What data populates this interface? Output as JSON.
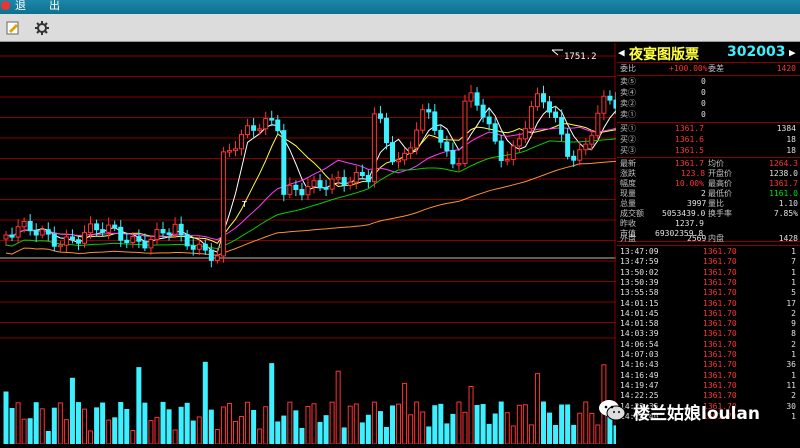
{
  "titlebar": {
    "menu_items": [
      "退",
      "出"
    ]
  },
  "toolbar": {
    "icons": [
      "edit-icon",
      "gear-icon"
    ]
  },
  "chart": {
    "high_label": "1751.2",
    "t_marker": "T"
  },
  "stock": {
    "name": "夜宴图版票",
    "code": "302003"
  },
  "quote_top": {
    "wei_label": "委比",
    "wei_value": "+100.00%",
    "weicha_label": "委差",
    "weicha_value": "1420"
  },
  "sell": [
    {
      "label": "卖⑤",
      "price": "",
      "vol": "0"
    },
    {
      "label": "卖④",
      "price": "",
      "vol": "0"
    },
    {
      "label": "卖②",
      "price": "",
      "vol": "0"
    },
    {
      "label": "卖①",
      "price": "",
      "vol": "0"
    }
  ],
  "buy": [
    {
      "label": "买①",
      "price": "1361.7",
      "vol": "1384"
    },
    {
      "label": "买②",
      "price": "1361.6",
      "vol": "18"
    },
    {
      "label": "买③",
      "price": "1361.5",
      "vol": "18"
    }
  ],
  "stats": [
    {
      "l1": "最新",
      "v1": "1361.7",
      "l2": "均价",
      "v2": "1264.3"
    },
    {
      "l1": "涨跌",
      "v1": "123.8",
      "l2": "开盘价",
      "v2": "1238.0"
    },
    {
      "l1": "幅度",
      "v1": "10.00%",
      "l2": "最高价",
      "v2": "1361.7"
    },
    {
      "l1": "现量",
      "v1": "2",
      "l2": "最低价",
      "v2": "1161.0"
    },
    {
      "l1": "总量",
      "v1": "3997",
      "l2": "量比",
      "v2": "1.10"
    },
    {
      "l1": "成交额",
      "v1": "5053439.0",
      "l2": "换手率",
      "v2": "7.85%"
    },
    {
      "l1": "昨收",
      "v1": "1237.9",
      "l2": "",
      "v2": ""
    },
    {
      "l1": "市值",
      "v1": "69302359.8",
      "l2": "",
      "v2": ""
    }
  ],
  "outin": {
    "out_label": "外盘",
    "out_value": "2569",
    "in_label": "内盘",
    "in_value": "1428"
  },
  "ticks": [
    {
      "time": "13:47:09",
      "price": "1361.70",
      "vol": "1"
    },
    {
      "time": "13:47:59",
      "price": "1361.70",
      "vol": "7"
    },
    {
      "time": "13:50:02",
      "price": "1361.70",
      "vol": "1"
    },
    {
      "time": "13:50:39",
      "price": "1361.70",
      "vol": "1"
    },
    {
      "time": "13:55:58",
      "price": "1361.70",
      "vol": "5"
    },
    {
      "time": "14:01:15",
      "price": "1361.70",
      "vol": "17"
    },
    {
      "time": "14:01:45",
      "price": "1361.70",
      "vol": "2"
    },
    {
      "time": "14:01:58",
      "price": "1361.70",
      "vol": "9"
    },
    {
      "time": "14:03:39",
      "price": "1361.70",
      "vol": "8"
    },
    {
      "time": "14:06:54",
      "price": "1361.70",
      "vol": "2"
    },
    {
      "time": "14:07:03",
      "price": "1361.70",
      "vol": "1"
    },
    {
      "time": "14:16:43",
      "price": "1361.70",
      "vol": "36"
    },
    {
      "time": "14:16:49",
      "price": "1361.70",
      "vol": "1"
    },
    {
      "time": "14:19:47",
      "price": "1361.70",
      "vol": "11"
    },
    {
      "time": "14:22:25",
      "price": "1361.70",
      "vol": "2"
    },
    {
      "time": "14:22:35",
      "price": "1361.70",
      "vol": "30"
    },
    {
      "time": "14:22:40",
      "price": "1361.70",
      "vol": "1"
    }
  ],
  "watermark": {
    "text": "楼兰姑娘loulan"
  },
  "colors": {
    "up": "#ff3232",
    "down": "#3cf0ff",
    "grid": "#8a0000"
  }
}
